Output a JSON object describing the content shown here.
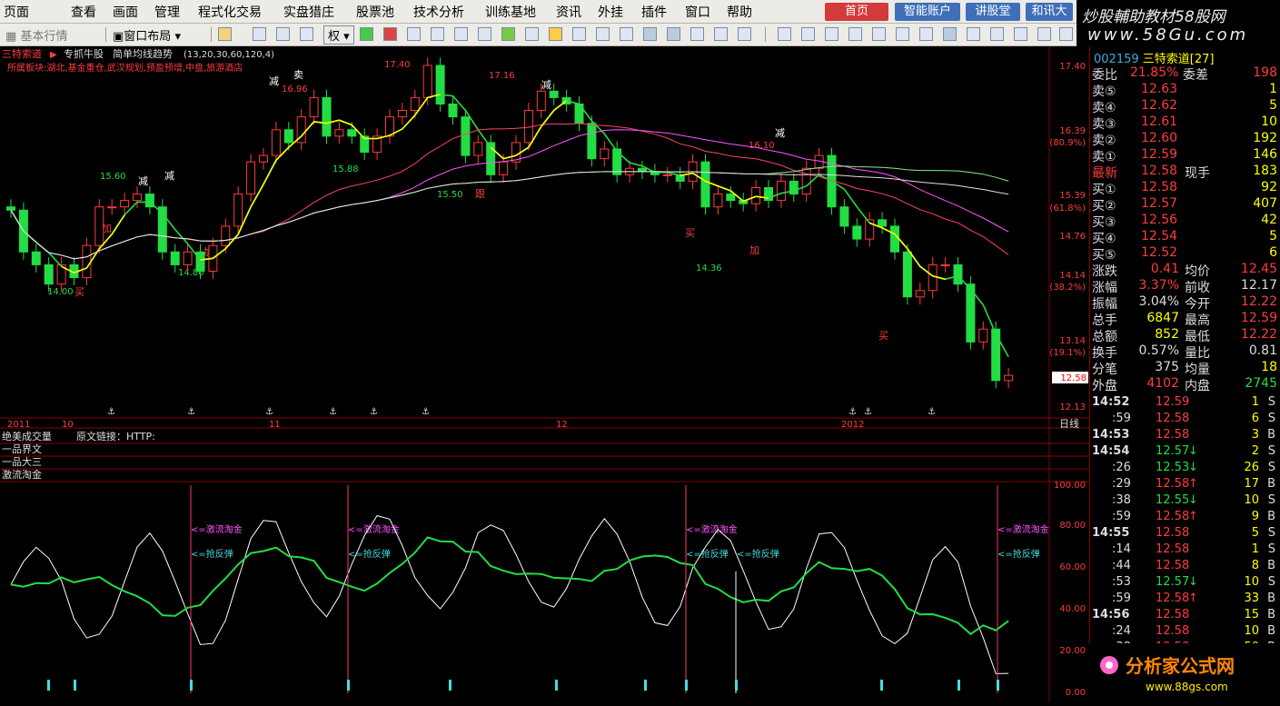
{
  "menu": [
    "页面",
    "查看",
    "画面",
    "管理",
    "程式化交易",
    "实盘猎庄",
    "股票池",
    "技术分析",
    "训练基地",
    "资讯",
    "外挂",
    "插件",
    "窗口",
    "帮助"
  ],
  "top_buttons": [
    "首页",
    "智能账户",
    "讲股堂",
    "和讯大"
  ],
  "brand": {
    "line1": "炒股輔助教材58股网",
    "line2": "www.58Gu.com"
  },
  "toolbar": {
    "market": "基本行情",
    "layout": "窗口布局",
    "rights": "权"
  },
  "chart": {
    "stock_name": "三特索道",
    "indicator_name": "专抓牛股",
    "ma_label": "简单均线趋势",
    "ma_params": "(13,20,30,60,120,4)",
    "concept": "所属板块:湖北,基金重仓,武汉规划,预盈预增,中盘,旅游酒店",
    "price_axis": [
      "17.40",
      "16.39",
      "(80.9%)",
      "15.39",
      "(61.8%)",
      "14.76",
      "14.14",
      "(38.2%)",
      "13.14",
      "(19.1%)",
      "12.13"
    ],
    "current_price_tag": "12.58",
    "date_labels": [
      "2011",
      "10",
      "11",
      "12",
      "2012"
    ],
    "period": "日线",
    "extrema": [
      "17.40",
      "17.16",
      "16.96",
      "16.10",
      "15.60",
      "15.88",
      "15.50",
      "14.00",
      "14.80",
      "14.36"
    ],
    "signals": [
      "卖",
      "减",
      "减",
      "减",
      "减",
      "减",
      "加",
      "加",
      "加",
      "买",
      "买",
      "买",
      "跟"
    ],
    "info_panel": {
      "title": "绝美成交量",
      "link": "原文链接：HTTP:",
      "row2": "一品界文",
      "row3": "一品大三"
    },
    "lower_title": "激流淘金",
    "lower_axis": [
      "100.00",
      "80.00",
      "60.00",
      "40.00",
      "20.00",
      "0.00"
    ],
    "lower_signals": {
      "main": "<=激流淘金",
      "rebound": "<=抢反弹"
    },
    "watermark": "分析家公式网"
  },
  "chart_data": {
    "type": "candlestick",
    "count": 80,
    "open": [
      15.2,
      15.15,
      14.5,
      14.3,
      14.0,
      14.3,
      14.1,
      14.6,
      15.2,
      15.2,
      15.3,
      15.4,
      15.2,
      14.5,
      14.3,
      14.5,
      14.2,
      14.6,
      14.9,
      15.4,
      15.9,
      16.0,
      16.4,
      16.2,
      16.6,
      16.9,
      16.3,
      16.4,
      16.3,
      16.05,
      16.3,
      16.6,
      16.7,
      16.9,
      17.4,
      16.8,
      16.6,
      16.0,
      16.2,
      15.7,
      15.9,
      16.2,
      16.7,
      17.0,
      16.9,
      16.8,
      16.5,
      15.95,
      16.1,
      15.7,
      15.8,
      15.75,
      15.7,
      15.7,
      15.6,
      15.9,
      15.2,
      15.4,
      15.3,
      15.25,
      15.5,
      15.3,
      15.6,
      15.4,
      15.8,
      16.0,
      15.2,
      14.9,
      14.7,
      15.0,
      14.9,
      14.5,
      13.8,
      13.9,
      14.3,
      14.3,
      14.0,
      13.1,
      13.3,
      12.5
    ],
    "close": [
      15.15,
      14.5,
      14.3,
      14.0,
      14.3,
      14.1,
      14.6,
      15.2,
      15.2,
      15.3,
      15.4,
      15.2,
      14.5,
      14.3,
      14.5,
      14.2,
      14.6,
      14.9,
      15.4,
      15.9,
      16.0,
      16.4,
      16.2,
      16.6,
      16.9,
      16.3,
      16.4,
      16.3,
      16.05,
      16.3,
      16.6,
      16.7,
      16.9,
      17.4,
      16.8,
      16.6,
      16.0,
      16.2,
      15.7,
      15.9,
      16.2,
      16.7,
      17.0,
      16.9,
      16.8,
      16.5,
      15.95,
      16.1,
      15.7,
      15.8,
      15.75,
      15.7,
      15.7,
      15.6,
      15.9,
      15.2,
      15.4,
      15.3,
      15.25,
      15.5,
      15.3,
      15.6,
      15.4,
      15.8,
      16.0,
      15.2,
      14.9,
      14.7,
      15.0,
      14.9,
      14.5,
      13.8,
      13.9,
      14.3,
      14.3,
      14.0,
      13.1,
      13.3,
      12.5,
      12.58
    ],
    "y_range": [
      12.13,
      17.4
    ],
    "lower_series": {
      "name": "激流淘金",
      "y_range": [
        0,
        100
      ]
    }
  },
  "quote": {
    "code": "002159",
    "name": "三特索道",
    "name_suffix": "[27]",
    "committee": {
      "label1": "委比",
      "val1": "21.85%",
      "label2": "委差",
      "val2": "198"
    },
    "asks": [
      {
        "l": "卖⑤",
        "p": "12.63",
        "v": "1"
      },
      {
        "l": "卖④",
        "p": "12.62",
        "v": "5"
      },
      {
        "l": "卖③",
        "p": "12.61",
        "v": "10"
      },
      {
        "l": "卖②",
        "p": "12.60",
        "v": "192"
      },
      {
        "l": "卖①",
        "p": "12.59",
        "v": "146"
      }
    ],
    "latest": {
      "l": "最新",
      "p": "12.58",
      "l2": "现手",
      "v": "183"
    },
    "bids": [
      {
        "l": "买①",
        "p": "12.58",
        "v": "92"
      },
      {
        "l": "买②",
        "p": "12.57",
        "v": "407"
      },
      {
        "l": "买③",
        "p": "12.56",
        "v": "42"
      },
      {
        "l": "买④",
        "p": "12.54",
        "v": "5"
      },
      {
        "l": "买⑤",
        "p": "12.52",
        "v": "6"
      }
    ],
    "stats": [
      {
        "l1": "涨跌",
        "v1": "0.41",
        "l2": "均价",
        "v2": "12.45"
      },
      {
        "l1": "涨幅",
        "v1": "3.37%",
        "l2": "前收",
        "v2": "12.17"
      },
      {
        "l1": "振幅",
        "v1": "3.04%",
        "l2": "今开",
        "v2": "12.22"
      },
      {
        "l1": "总手",
        "v1": "6847",
        "l2": "最高",
        "v2": "12.59"
      },
      {
        "l1": "总额",
        "v1": "852",
        "l2": "最低",
        "v2": "12.22"
      },
      {
        "l1": "换手",
        "v1": "0.57%",
        "l2": "量比",
        "v2": "0.81"
      },
      {
        "l1": "分笔",
        "v1": "375",
        "l2": "均量",
        "v2": "18"
      },
      {
        "l1": "外盘",
        "v1": "4102",
        "l2": "内盘",
        "v2": "2745"
      }
    ],
    "ticks": [
      {
        "t": "14:52",
        "p": "12.59",
        "v": "1",
        "s": "S"
      },
      {
        "t": ":59",
        "p": "12.58",
        "v": "6",
        "s": "S"
      },
      {
        "t": "14:53",
        "p": "12.58",
        "v": "3",
        "s": "B"
      },
      {
        "t": "14:54",
        "p": "12.57",
        "v": "2",
        "s": "S"
      },
      {
        "t": ":26",
        "p": "12.53",
        "v": "26",
        "s": "S"
      },
      {
        "t": ":29",
        "p": "12.58",
        "v": "17",
        "s": "B"
      },
      {
        "t": ":38",
        "p": "12.55",
        "v": "10",
        "s": "S"
      },
      {
        "t": ":59",
        "p": "12.58",
        "v": "9",
        "s": "B"
      },
      {
        "t": "14:55",
        "p": "12.58",
        "v": "5",
        "s": "S"
      },
      {
        "t": ":14",
        "p": "12.58",
        "v": "1",
        "s": "S"
      },
      {
        "t": ":44",
        "p": "12.58",
        "v": "8",
        "s": "B"
      },
      {
        "t": ":53",
        "p": "12.57",
        "v": "10",
        "s": "S"
      },
      {
        "t": ":59",
        "p": "12.58",
        "v": "33",
        "s": "B"
      },
      {
        "t": "14:56",
        "p": "12.58",
        "v": "15",
        "s": "B"
      },
      {
        "t": ":24",
        "p": "12.58",
        "v": "10",
        "s": "B"
      },
      {
        "t": ":38",
        "p": "12.58",
        "v": "50",
        "s": "B"
      }
    ]
  },
  "colors": {
    "up": "#ff3c3c",
    "down": "#22dd44",
    "yellow": "#ffff00",
    "cyan": "#44dddd",
    "magenta": "#ff55ff",
    "grid": "#8a0000"
  },
  "logo": {
    "main": "分析家公式网",
    "url": "www.88gs.com"
  }
}
